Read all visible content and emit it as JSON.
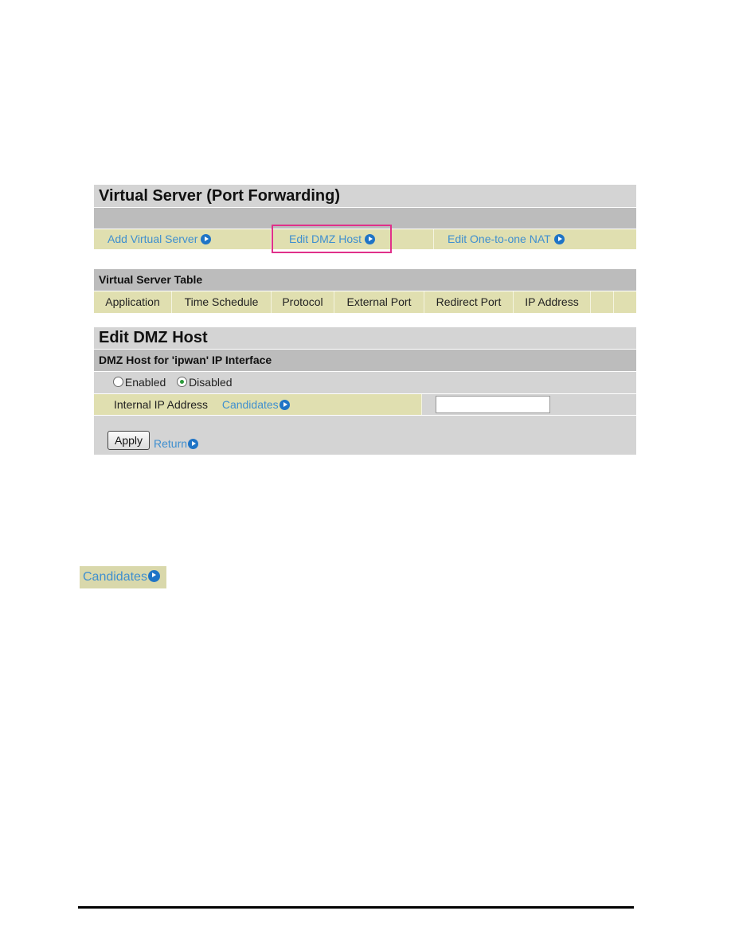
{
  "virtual_server": {
    "title": "Virtual Server (Port Forwarding)",
    "nav": [
      {
        "label": "Add Virtual Server",
        "icon": "play-circle-icon"
      },
      {
        "label": "Edit DMZ Host",
        "icon": "play-circle-icon",
        "highlighted": true
      },
      {
        "label": "Edit One-to-one NAT",
        "icon": "play-circle-icon"
      }
    ]
  },
  "vs_table": {
    "title": "Virtual Server Table",
    "columns": [
      "Application",
      "Time Schedule",
      "Protocol",
      "External Port",
      "Redirect Port",
      "IP Address",
      "",
      ""
    ]
  },
  "dmz": {
    "title": "Edit DMZ Host",
    "subtitle": "DMZ Host for 'ipwan' IP Interface",
    "radio_enabled": "Enabled",
    "radio_disabled": "Disabled",
    "selected": "Disabled",
    "ip_label": "Internal IP Address",
    "candidates_label": "Candidates",
    "ip_value": "",
    "apply_label": "Apply",
    "return_label": "Return"
  },
  "standalone": {
    "candidates_label": "Candidates"
  },
  "colors": {
    "link": "#3f8fcf",
    "accent_icon": "#1f74c6",
    "highlight_border": "#e0308a",
    "row_tan": "#e0dfb0",
    "header_grey": "#bcbcbc"
  }
}
